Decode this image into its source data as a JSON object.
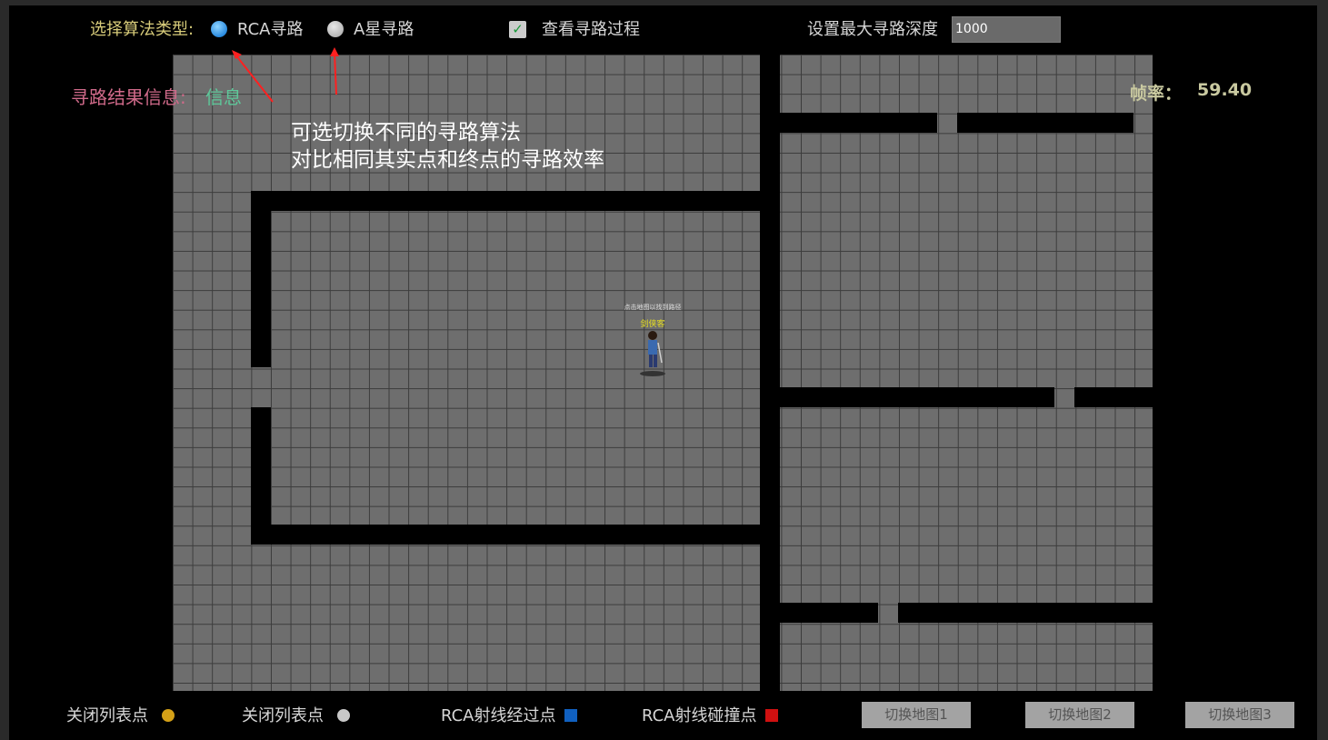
{
  "toolbar": {
    "algo_label": "选择算法类型:",
    "rca_label": "RCA寻路",
    "astar_label": "A星寻路",
    "selected": "RCA寻路",
    "view_process_label": "查看寻路过程",
    "view_process_checked": true,
    "max_depth_label": "设置最大寻路深度",
    "max_depth_value": "1000"
  },
  "result": {
    "label": "寻路结果信息:",
    "value": "信息"
  },
  "fps": {
    "label": "帧率：",
    "value": "59.40"
  },
  "annotation": {
    "line1": "可选切换不同的寻路算法",
    "line2": "对比相同其实点和终点的寻路效率"
  },
  "character": {
    "hint": "点击地图以找到路径",
    "name": "剑侠客"
  },
  "legend": [
    {
      "label": "关闭列表点",
      "color": "#d4a017"
    },
    {
      "label": "关闭列表点",
      "color": "#c8c8c8"
    },
    {
      "label": "RCA射线经过点",
      "color": "#1060c0"
    },
    {
      "label": "RCA射线碰撞点",
      "color": "#d01010"
    }
  ],
  "buttons": {
    "map1": "切换地图1",
    "map2": "切换地图2",
    "map3": "切换地图3"
  },
  "colors": {
    "algo_label": "#d8cc7a",
    "result_label": "#d06a8a",
    "result_value": "#5ec89a",
    "annotation_arrow": "#ff2020"
  }
}
